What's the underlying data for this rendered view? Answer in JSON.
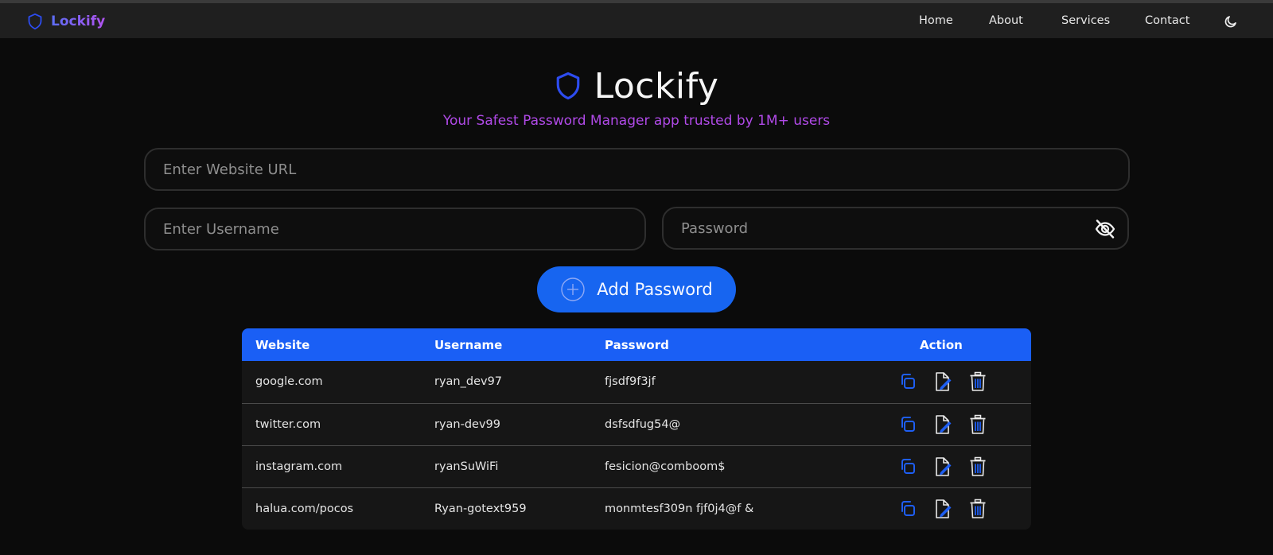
{
  "nav": {
    "brand": "Lockify",
    "links": [
      "Home",
      "About",
      "Services",
      "Contact"
    ],
    "theme_icon": "moon-icon"
  },
  "hero": {
    "title": "Lockify",
    "tagline": "Your Safest Password Manager app trusted by 1M+ users"
  },
  "form": {
    "url_placeholder": "Enter Website URL",
    "username_placeholder": "Enter Username",
    "password_placeholder": "Password",
    "add_label": "Add Password"
  },
  "table": {
    "headers": [
      "Website",
      "Username",
      "Password",
      "Action"
    ],
    "rows": [
      {
        "website": "google.com",
        "username": "ryan_dev97",
        "password": "fjsdf9f3jf"
      },
      {
        "website": "twitter.com",
        "username": "ryan-dev99",
        "password": "dsfsdfug54@"
      },
      {
        "website": "instagram.com",
        "username": "ryanSuWiFi",
        "password": "fesicion@comboom$"
      },
      {
        "website": "halua.com/pocos",
        "username": "Ryan-gotext959",
        "password": "monmtesf309n fjf0j4@f &"
      }
    ]
  },
  "colors": {
    "accent": "#1765f0",
    "tagline": "#b14ae8",
    "brand_gradient_start": "#5b6ef6",
    "brand_gradient_end": "#b153f0"
  }
}
